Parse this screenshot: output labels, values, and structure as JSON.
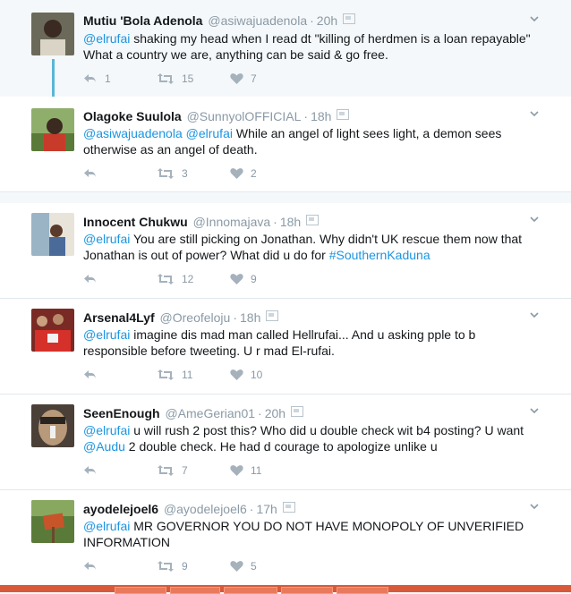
{
  "tweets": [
    {
      "name": "Mutiu 'Bola Adenola",
      "handle": "@asiwajuadenola",
      "time": "20h",
      "text_pre": "",
      "text_links": [
        {
          "t": "@elrufai",
          "link": true
        },
        {
          "t": " shaking my head when I read dt \"killing of herdmen is a loan repayable\" What a country we are, anything can be said & go free.",
          "link": false
        }
      ],
      "reply_count": "1",
      "retweet_count": "15",
      "like_count": "7"
    },
    {
      "name": "Olagoke Suulola",
      "handle": "@SunnyolOFFICIAL",
      "time": "18h",
      "text_links": [
        {
          "t": "@asiwajuadenola",
          "link": true
        },
        {
          "t": " ",
          "link": false
        },
        {
          "t": "@elrufai",
          "link": true
        },
        {
          "t": " While an angel of light sees light, a demon sees otherwise as an angel of death.",
          "link": false
        }
      ],
      "reply_count": "",
      "retweet_count": "3",
      "like_count": "2"
    },
    {
      "name": "Innocent Chukwu",
      "handle": "@Innomajava",
      "time": "18h",
      "text_links": [
        {
          "t": "@elrufai",
          "link": true
        },
        {
          "t": " You are still picking on Jonathan. Why didn't UK rescue them now that Jonathan is out of power? What did u do for ",
          "link": false
        },
        {
          "t": "#SouthernKaduna",
          "link": true
        }
      ],
      "reply_count": "",
      "retweet_count": "12",
      "like_count": "9"
    },
    {
      "name": "Arsenal4Lyf",
      "handle": "@Oreofeloju",
      "time": "18h",
      "text_links": [
        {
          "t": "@elrufai",
          "link": true
        },
        {
          "t": " imagine dis mad man called Hellrufai... And u asking pple to b responsible before tweeting. U r mad El-rufai.",
          "link": false
        }
      ],
      "reply_count": "",
      "retweet_count": "11",
      "like_count": "10"
    },
    {
      "name": "SeenEnough",
      "handle": "@AmeGerian01",
      "time": "20h",
      "text_links": [
        {
          "t": "@elrufai",
          "link": true
        },
        {
          "t": " u will rush 2 post this? Who did u double check wit b4 posting? U want ",
          "link": false
        },
        {
          "t": "@Audu",
          "link": true
        },
        {
          "t": " 2 double check. He had d courage to apologize unlike u",
          "link": false
        }
      ],
      "reply_count": "",
      "retweet_count": "7",
      "like_count": "11"
    },
    {
      "name": "ayodelejoel6",
      "handle": "@ayodelejoel6",
      "time": "17h",
      "text_links": [
        {
          "t": "@elrufai",
          "link": true
        },
        {
          "t": " MR GOVERNOR YOU DO NOT HAVE MONOPOLY OF UNVERIFIED INFORMATION",
          "link": false
        }
      ],
      "reply_count": "",
      "retweet_count": "9",
      "like_count": "5"
    }
  ],
  "colors": {
    "link": "#1b95e0",
    "muted": "#8a9aa6",
    "thread_line": "#5ab7d6",
    "taskbar": "#d8593a"
  }
}
